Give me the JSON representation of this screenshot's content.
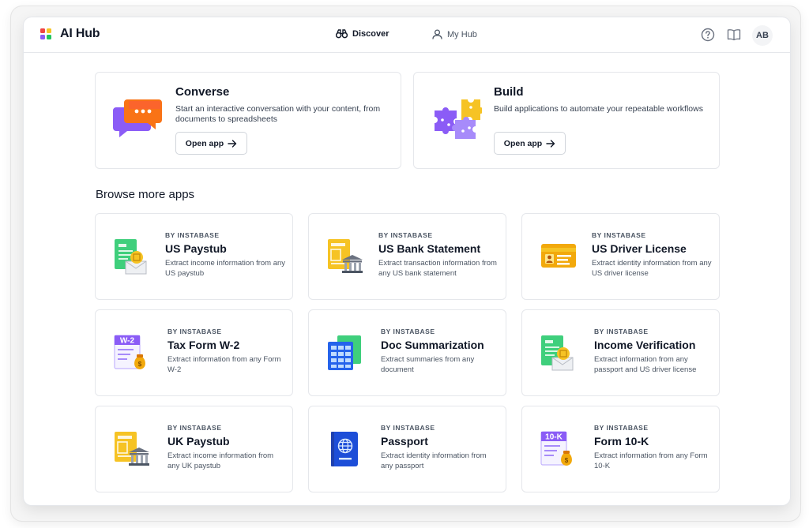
{
  "app": {
    "title": "AI Hub"
  },
  "nav": {
    "tabs": [
      {
        "label": "Discover",
        "icon": "binoculars-icon",
        "active": true
      },
      {
        "label": "My Hub",
        "icon": "user-icon",
        "active": false
      }
    ]
  },
  "header": {
    "icons": [
      "help-icon",
      "book-icon"
    ],
    "avatar_initials": "AB"
  },
  "features": [
    {
      "title": "Converse",
      "description": "Start an interactive conversation with your content, from documents to spreadsheets",
      "button": "Open app",
      "icon": "chat-bubbles-icon"
    },
    {
      "title": "Build",
      "description": "Build applications to automate your repeatable workflows",
      "button": "Open app",
      "icon": "puzzle-icon"
    }
  ],
  "browse": {
    "title": "Browse more apps",
    "apps": [
      {
        "by": "BY INSTABASE",
        "title": "US Paystub",
        "description": "Extract income information from any US paystub",
        "icon": "paystub-icon"
      },
      {
        "by": "BY INSTABASE",
        "title": "US Bank Statement",
        "description": "Extract transaction information from any US bank statement",
        "icon": "bank-statement-icon"
      },
      {
        "by": "BY INSTABASE",
        "title": "US Driver License",
        "description": "Extract identity information from any US driver license",
        "icon": "driver-license-icon"
      },
      {
        "by": "BY INSTABASE",
        "title": "Tax Form W-2",
        "description": "Extract information from any Form W-2",
        "icon": "w2-form-icon",
        "badge": "W-2"
      },
      {
        "by": "BY INSTABASE",
        "title": "Doc Summarization",
        "description": "Extract summaries from any document",
        "icon": "spreadsheet-icon"
      },
      {
        "by": "BY INSTABASE",
        "title": "Income Verification",
        "description": "Extract information from any passport and US driver license",
        "icon": "income-verification-icon"
      },
      {
        "by": "BY INSTABASE",
        "title": "UK Paystub",
        "description": "Extract income information from any UK paystub",
        "icon": "uk-paystub-icon"
      },
      {
        "by": "BY INSTABASE",
        "title": "Passport",
        "description": "Extract identity information from any passport",
        "icon": "passport-icon"
      },
      {
        "by": "BY INSTABASE",
        "title": "Form 10-K",
        "description": "Extract information from any Form 10-K",
        "icon": "form-10k-icon",
        "badge": "10-K"
      }
    ]
  },
  "colors": {
    "green": "#3fcf7c",
    "yellow": "#f6c324",
    "purple": "#8b5cf6",
    "orange": "#f2a90c",
    "blue": "#2563eb",
    "red": "#ef4444"
  }
}
